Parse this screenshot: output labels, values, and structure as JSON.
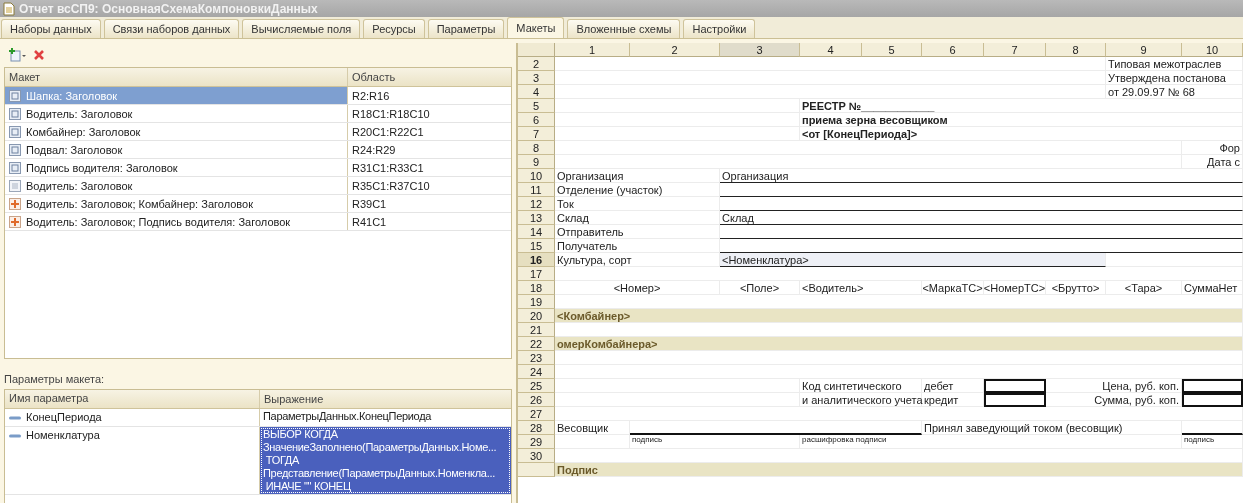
{
  "window": {
    "title": "Отчет всСП9: ОсновнаяСхемаКомпоновкиДанных"
  },
  "tabs": [
    {
      "label": "Наборы данных",
      "selected": false
    },
    {
      "label": "Связи наборов данных",
      "selected": false
    },
    {
      "label": "Вычисляемые поля",
      "selected": false
    },
    {
      "label": "Ресурсы",
      "selected": false
    },
    {
      "label": "Параметры",
      "selected": false
    },
    {
      "label": "Макеты",
      "selected": true
    },
    {
      "label": "Вложенные схемы",
      "selected": false
    },
    {
      "label": "Настройки",
      "selected": false
    }
  ],
  "layouts": {
    "columns": [
      "Макет",
      "Область"
    ],
    "rows": [
      {
        "kind": "area",
        "name": "Шапка: Заголовок",
        "range": "R2:R16",
        "selected": true
      },
      {
        "kind": "area",
        "name": "Водитель: Заголовок",
        "range": "R18C1:R18C10",
        "selected": false
      },
      {
        "kind": "area",
        "name": "Комбайнер: Заголовок",
        "range": "R20C1:R22C1",
        "selected": false
      },
      {
        "kind": "area",
        "name": "Подвал: Заголовок",
        "range": "R24:R29",
        "selected": false
      },
      {
        "kind": "area",
        "name": "Подпись водителя: Заголовок",
        "range": "R31C1:R33C1",
        "selected": false
      },
      {
        "kind": "plain",
        "name": "Водитель: Заголовок",
        "range": "R35C1:R37C10",
        "selected": false
      },
      {
        "kind": "combined",
        "name": "Водитель: Заголовок; Комбайнер: Заголовок",
        "range": "R39C1",
        "selected": false
      },
      {
        "kind": "combined",
        "name": "Водитель: Заголовок; Подпись водителя: Заголовок",
        "range": "R41C1",
        "selected": false
      }
    ]
  },
  "parameters": {
    "label": "Параметры макета:",
    "columns": [
      "Имя параметра",
      "Выражение"
    ],
    "rows": [
      {
        "name": "КонецПериода",
        "expression": [
          "ПараметрыДанных.КонецПериода"
        ],
        "selected": false
      },
      {
        "name": "Номенклатура",
        "expression": [
          "ВЫБОР КОГДА",
          "ЗначениеЗаполнено(ПараметрыДанных.Номе...",
          " ТОГДА",
          "Представление(ПараметрыДанных.Номенкла...",
          " ИНАЧЕ \"\" КОНЕЦ"
        ],
        "selected": true
      }
    ]
  },
  "sheet": {
    "columns": [
      {
        "label": "1",
        "selected": false
      },
      {
        "label": "2",
        "selected": false
      },
      {
        "label": "3",
        "selected": true
      },
      {
        "label": "4",
        "selected": false
      },
      {
        "label": "5",
        "selected": false
      },
      {
        "label": "6",
        "selected": false
      },
      {
        "label": "7",
        "selected": false
      },
      {
        "label": "8",
        "selected": false
      },
      {
        "label": "9",
        "selected": false
      },
      {
        "label": "10",
        "selected": false
      }
    ],
    "rows": [
      {
        "number": "2",
        "selected": false,
        "cells": [
          "",
          "",
          "",
          "",
          "",
          "",
          "",
          "",
          {
            "text": "Типовая межотраслев",
            "kind": "text"
          },
          ""
        ]
      },
      {
        "number": "3",
        "selected": false,
        "cells": [
          "",
          "",
          "",
          "",
          "",
          "",
          "",
          "",
          {
            "text": "Утверждена постанова",
            "kind": "text"
          },
          ""
        ]
      },
      {
        "number": "4",
        "selected": false,
        "cells": [
          "",
          "",
          "",
          "",
          "",
          "",
          "",
          "",
          {
            "text": "от 29.09.97 № 68",
            "kind": "text"
          },
          ""
        ]
      },
      {
        "number": "5",
        "selected": false,
        "cells": [
          "",
          "",
          "",
          {
            "text": "РЕЕСТР №____________",
            "kind": "bold"
          },
          "",
          "",
          "",
          "",
          "",
          ""
        ]
      },
      {
        "number": "6",
        "selected": false,
        "cells": [
          "",
          "",
          "",
          {
            "text": "приема зерна весовщиком",
            "kind": "bold"
          },
          "",
          "",
          "",
          "",
          "",
          ""
        ]
      },
      {
        "number": "7",
        "selected": false,
        "cells": [
          "",
          "",
          "",
          {
            "text": "<от [КонецПериода]>",
            "kind": "bold"
          },
          "",
          "",
          "",
          "",
          "",
          ""
        ]
      },
      {
        "number": "8",
        "selected": false,
        "cells": [
          "",
          "",
          "",
          "",
          "",
          "",
          "",
          "",
          "",
          {
            "text": "Фор",
            "kind": "right"
          }
        ]
      },
      {
        "number": "9",
        "selected": false,
        "cells": [
          "",
          "",
          "",
          "",
          "",
          "",
          "",
          "",
          "",
          {
            "text": "Дата с",
            "kind": "right"
          }
        ]
      },
      {
        "number": "10",
        "selected": false,
        "cells": [
          {
            "text": "Организация",
            "kind": "text"
          },
          "",
          {
            "text": "Организация",
            "kind": "text",
            "underlined": true
          },
          {
            "kind": "line"
          },
          {
            "kind": "line"
          },
          {
            "kind": "line"
          },
          {
            "kind": "line"
          },
          {
            "kind": "line"
          },
          {
            "kind": "line"
          },
          {
            "kind": "line"
          }
        ]
      },
      {
        "number": "11",
        "selected": false,
        "cells": [
          {
            "text": "Отделение (участок)",
            "kind": "text"
          },
          "",
          {
            "kind": "line"
          },
          {
            "kind": "line"
          },
          {
            "kind": "line"
          },
          {
            "kind": "line"
          },
          {
            "kind": "line"
          },
          {
            "kind": "line"
          },
          {
            "kind": "line"
          },
          {
            "kind": "line"
          }
        ]
      },
      {
        "number": "12",
        "selected": false,
        "cells": [
          {
            "text": "Ток",
            "kind": "text"
          },
          "",
          {
            "kind": "line"
          },
          {
            "kind": "line"
          },
          {
            "kind": "line"
          },
          {
            "kind": "line"
          },
          {
            "kind": "line"
          },
          {
            "kind": "line"
          },
          {
            "kind": "line"
          },
          {
            "kind": "line"
          }
        ]
      },
      {
        "number": "13",
        "selected": false,
        "cells": [
          {
            "text": "Склад",
            "kind": "text"
          },
          "",
          {
            "text": "Склад",
            "kind": "text",
            "underlined": true
          },
          {
            "kind": "line"
          },
          {
            "kind": "line"
          },
          {
            "kind": "line"
          },
          {
            "kind": "line"
          },
          {
            "kind": "line"
          },
          {
            "kind": "line"
          },
          {
            "kind": "line"
          }
        ]
      },
      {
        "number": "14",
        "selected": false,
        "cells": [
          {
            "text": "Отправитель",
            "kind": "text"
          },
          "",
          {
            "kind": "line"
          },
          {
            "kind": "line"
          },
          {
            "kind": "line"
          },
          {
            "kind": "line"
          },
          {
            "kind": "line"
          },
          {
            "kind": "line"
          },
          {
            "kind": "line"
          },
          {
            "kind": "line"
          }
        ]
      },
      {
        "number": "15",
        "selected": false,
        "cells": [
          {
            "text": "Получатель",
            "kind": "text"
          },
          "",
          {
            "kind": "line"
          },
          {
            "kind": "line"
          },
          {
            "kind": "line"
          },
          {
            "kind": "line"
          },
          {
            "kind": "line"
          },
          {
            "kind": "line"
          },
          {
            "kind": "line"
          },
          {
            "kind": "line"
          }
        ]
      },
      {
        "number": "16",
        "selected": true,
        "cells": [
          {
            "text": "Культура, сорт",
            "kind": "text"
          },
          "",
          {
            "text": "<Номенклатура>",
            "kind": "current",
            "underlined": true
          },
          {
            "kind": "line"
          },
          {
            "kind": "line"
          },
          {
            "kind": "line"
          },
          {
            "kind": "line"
          },
          {
            "kind": "line"
          },
          "",
          ""
        ]
      },
      {
        "number": "17",
        "selected": false,
        "cells": [
          "",
          "",
          "",
          "",
          "",
          "",
          "",
          "",
          "",
          ""
        ]
      },
      {
        "number": "18",
        "selected": false,
        "cells": [
          {
            "text": "<Номер>",
            "kind": "center"
          },
          "",
          {
            "text": "<Поле>",
            "kind": "center"
          },
          {
            "text": "<Водитель>",
            "kind": "text"
          },
          "",
          {
            "text": "<МаркаТС>",
            "kind": "center"
          },
          {
            "text": "<НомерТС>",
            "kind": "center"
          },
          {
            "text": "<Брутто>",
            "kind": "center"
          },
          {
            "text": "<Тара>",
            "kind": "center"
          },
          {
            "text": "СуммаНет",
            "kind": "text"
          }
        ]
      },
      {
        "number": "19",
        "selected": false,
        "cells": [
          "",
          "",
          "",
          "",
          "",
          "",
          "",
          "",
          "",
          ""
        ]
      },
      {
        "number": "20",
        "selected": false,
        "cells": [
          {
            "text": "<Комбайнер>",
            "kind": "group"
          },
          "",
          "",
          "",
          "",
          "",
          "",
          "",
          "",
          ""
        ]
      },
      {
        "number": "21",
        "selected": false,
        "cells": [
          "",
          "",
          "",
          "",
          "",
          "",
          "",
          "",
          "",
          ""
        ]
      },
      {
        "number": "22",
        "selected": false,
        "cells": [
          {
            "text": "омерКомбайнера>",
            "kind": "group"
          },
          "",
          "",
          "",
          "",
          "",
          "",
          "",
          "",
          ""
        ]
      },
      {
        "number": "23",
        "selected": false,
        "cells": [
          "",
          "",
          "",
          "",
          "",
          "",
          "",
          "",
          "",
          ""
        ]
      },
      {
        "number": "24",
        "selected": false,
        "cells": [
          "",
          "",
          "",
          "",
          "",
          "",
          "",
          "",
          "",
          ""
        ]
      },
      {
        "number": "25",
        "selected": false,
        "cells": [
          "",
          "",
          "",
          {
            "text": "Код синтетического",
            "kind": "text"
          },
          "",
          {
            "text": "дебет",
            "kind": "text"
          },
          {
            "kind": "box"
          },
          {
            "text": "Цена, руб. коп.",
            "kind": "right"
          },
          "",
          {
            "kind": "box"
          }
        ]
      },
      {
        "number": "26",
        "selected": false,
        "cells": [
          "",
          "",
          "",
          {
            "text": "и аналитического учета",
            "kind": "text"
          },
          "",
          {
            "text": "кредит",
            "kind": "text"
          },
          {
            "kind": "box"
          },
          {
            "text": "Сумма, руб. коп.",
            "kind": "right"
          },
          "",
          {
            "kind": "box"
          }
        ]
      },
      {
        "number": "27",
        "selected": false,
        "cells": [
          "",
          "",
          "",
          "",
          "",
          "",
          "",
          "",
          "",
          ""
        ]
      },
      {
        "number": "28",
        "selected": false,
        "cells": [
          {
            "text": "Весовщик",
            "kind": "text"
          },
          {
            "kind": "signature"
          },
          {
            "kind": "signature"
          },
          {
            "kind": "signature"
          },
          {
            "kind": "signature"
          },
          {
            "text": "Принял заведующий током (весовщик)",
            "kind": "text"
          },
          "",
          "",
          "",
          {
            "kind": "signature"
          }
        ]
      },
      {
        "number": "29",
        "selected": false,
        "cells": [
          "",
          {
            "text": "подпись",
            "kind": "small"
          },
          "",
          {
            "text": "расшифровка подписи",
            "kind": "small"
          },
          "",
          "",
          "",
          "",
          "",
          {
            "text": "подпись",
            "kind": "small"
          }
        ]
      },
      {
        "number": "30",
        "selected": false,
        "cells": [
          "",
          "",
          "",
          "",
          "",
          "",
          "",
          "",
          "",
          ""
        ]
      },
      {
        "selected": false,
        "cells": [
          {
            "text": "Подпис",
            "kind": "group"
          },
          "",
          "",
          "",
          "",
          "",
          "",
          "",
          "",
          ""
        ]
      }
    ]
  }
}
